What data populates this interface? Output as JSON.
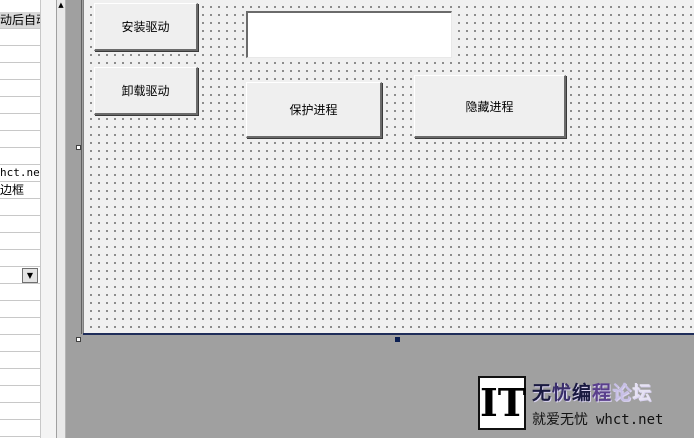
{
  "property_panel": {
    "rows": [
      {
        "text": "动后自动",
        "style": "sel"
      },
      {
        "text": "",
        "style": ""
      },
      {
        "text": "",
        "style": ""
      },
      {
        "text": "",
        "style": ""
      },
      {
        "text": "",
        "style": ""
      },
      {
        "text": "",
        "style": ""
      },
      {
        "text": "",
        "style": ""
      },
      {
        "text": "",
        "style": ""
      },
      {
        "text": "",
        "style": ""
      },
      {
        "text": "hct.net",
        "style": "mono"
      },
      {
        "text": "边框",
        "style": ""
      },
      {
        "text": "",
        "style": ""
      },
      {
        "text": "",
        "style": ""
      },
      {
        "text": "",
        "style": ""
      },
      {
        "text": "",
        "style": ""
      },
      {
        "text": "",
        "style": ""
      },
      {
        "text": "",
        "style": ""
      },
      {
        "text": "",
        "style": ""
      },
      {
        "text": "",
        "style": ""
      },
      {
        "text": "",
        "style": ""
      },
      {
        "text": "",
        "style": ""
      },
      {
        "text": "",
        "style": ""
      },
      {
        "text": "",
        "style": ""
      },
      {
        "text": "",
        "style": ""
      },
      {
        "text": "",
        "style": ""
      }
    ],
    "dropdown_icon": "chevron-down-icon",
    "dropdown_glyph": "▼"
  },
  "scrollbar": {
    "up_glyph": "▲"
  },
  "form": {
    "buttons": {
      "install": "安装驱动",
      "uninstall": "卸载驱动",
      "protect": "保护进程",
      "hide": "隐藏进程"
    },
    "edit_value": ""
  },
  "logo": {
    "it": "IT",
    "line1": [
      "无",
      "忧",
      "编",
      "程",
      "论",
      "坛"
    ],
    "line2_cn": "就爱无忧",
    "line2_url": "whct.net"
  },
  "colors": {
    "canvas_bg": "#f0f0f0",
    "workspace_bg": "#a0a0a0",
    "form_border": "#1f2d5a"
  }
}
